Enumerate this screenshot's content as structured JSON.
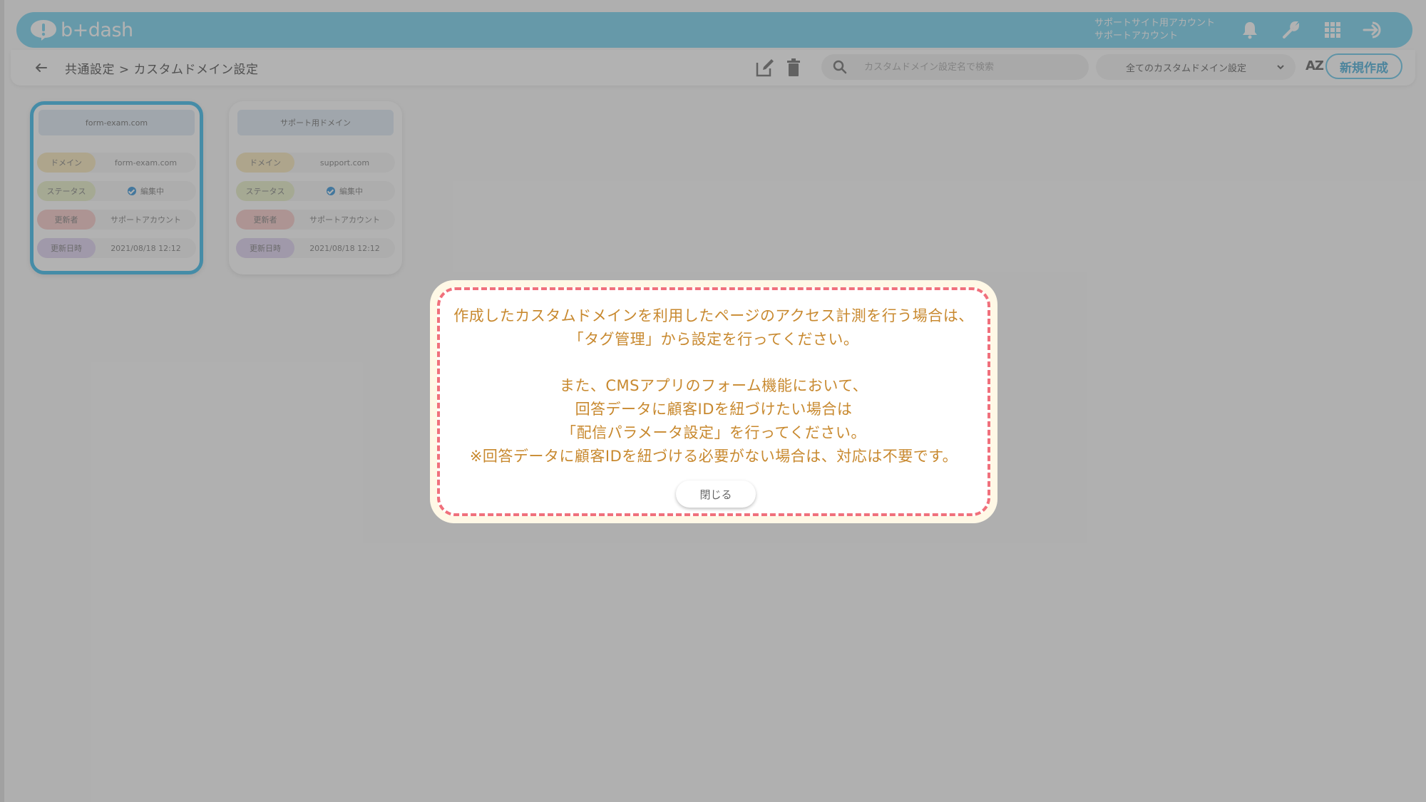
{
  "header": {
    "logo_text": "b+dash",
    "account_line1": "サポートサイト用アカウント",
    "account_line2": "サポートアカウント",
    "icons": [
      "bell-icon",
      "wrench-icon",
      "grid-icon",
      "logout-icon"
    ]
  },
  "subbar": {
    "breadcrumb": "共通設定 > カスタムドメイン設定",
    "search_placeholder": "カスタムドメイン設定名で検索",
    "filter_value": "全てのカスタムドメイン設定",
    "sort_label": "AZ",
    "new_button": "新規作成"
  },
  "cards": [
    {
      "title": "form-exam.com",
      "selected": true,
      "rows": [
        {
          "label": "ドメイン",
          "value": "form-exam.com"
        },
        {
          "label": "ステータス",
          "value": "編集中"
        },
        {
          "label": "更新者",
          "value": "サポートアカウント"
        },
        {
          "label": "更新日時",
          "value": "2021/08/18 12:12"
        }
      ]
    },
    {
      "title": "サポート用ドメイン",
      "selected": false,
      "rows": [
        {
          "label": "ドメイン",
          "value": "support.com"
        },
        {
          "label": "ステータス",
          "value": "編集中"
        },
        {
          "label": "更新者",
          "value": "サポートアカウント"
        },
        {
          "label": "更新日時",
          "value": "2021/08/18 12:12"
        }
      ]
    }
  ],
  "dialog": {
    "lines_a": [
      "作成したカスタムドメインを利用したページのアクセス計測を行う場合は、",
      "「タグ管理」から設定を行ってください。"
    ],
    "lines_b": [
      "また、CMSアプリのフォーム機能において、",
      "回答データに顧客IDを紐づけたい場合は",
      "「配信パラメータ設定」を行ってください。",
      "※回答データに顧客IDを紐づける必要がない場合は、対応は不要です。"
    ],
    "close_button": "閉じる"
  },
  "colors": {
    "header": "#6ecfee",
    "accent": "#2eb6ea",
    "dialog_text": "#c8892f",
    "dialog_border": "#f0707c",
    "overlay": "rgba(95,95,95,0.48)"
  }
}
